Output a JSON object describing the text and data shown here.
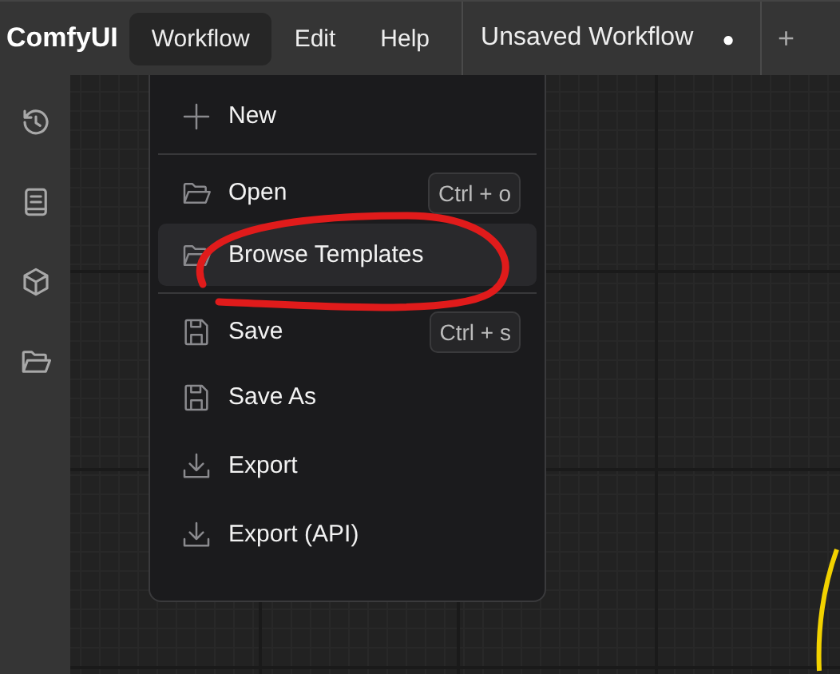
{
  "topbar": {
    "logo": "ComfyUI",
    "menus": [
      {
        "label": "Workflow",
        "selected": true
      },
      {
        "label": "Edit",
        "selected": false
      },
      {
        "label": "Help",
        "selected": false
      }
    ],
    "tab": {
      "title": "Unsaved Workflow",
      "unsaved": true,
      "dot": "●"
    },
    "new_tab": "+"
  },
  "menu": {
    "items": [
      {
        "kind": "item",
        "label": "New",
        "highlighted": false
      },
      {
        "kind": "divider"
      },
      {
        "kind": "item",
        "label": "Open",
        "shortcut": "Ctrl + o",
        "highlighted": false
      },
      {
        "kind": "item",
        "label": "Browse Templates",
        "highlighted": true
      },
      {
        "kind": "divider"
      },
      {
        "kind": "item",
        "label": "Save",
        "shortcut": "Ctrl + s",
        "highlighted": false
      },
      {
        "kind": "item",
        "label": "Save As",
        "highlighted": false
      },
      {
        "kind": "item",
        "label": "Export",
        "highlighted": false
      },
      {
        "kind": "item",
        "label": "Export (API)",
        "highlighted": false
      }
    ]
  }
}
